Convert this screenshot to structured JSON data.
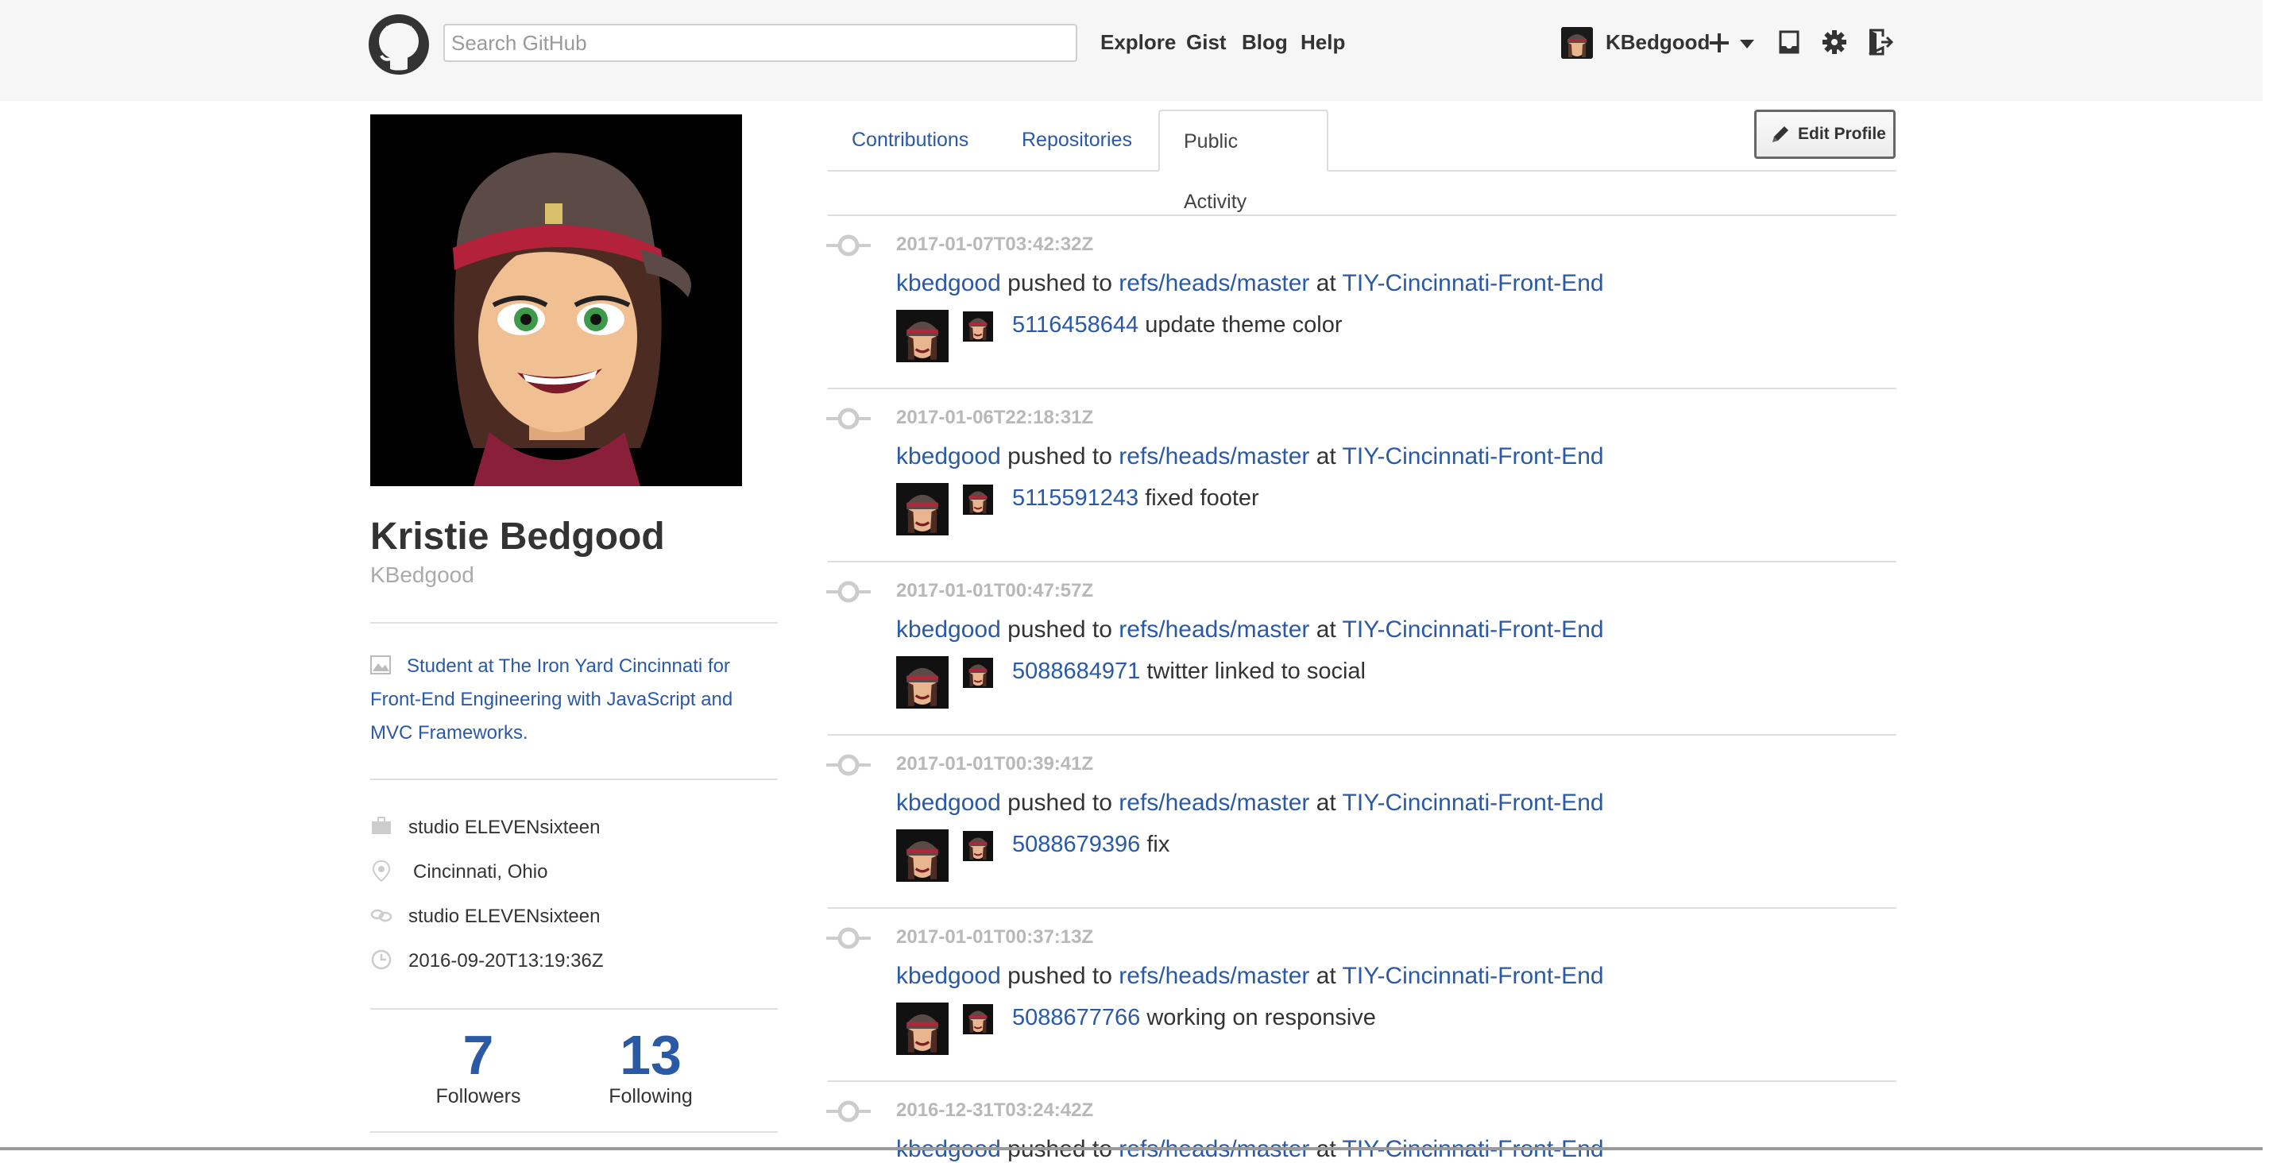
{
  "header": {
    "search_placeholder": "Search GitHub",
    "nav": [
      "Explore",
      "Gist",
      "Blog",
      "Help"
    ],
    "username": "KBedgood",
    "icons": [
      "github-logo-icon",
      "plus-icon",
      "chevron-down-icon",
      "inbox-icon",
      "gear-icon",
      "sign-out-icon"
    ]
  },
  "profile": {
    "full_name": "Kristie Bedgood",
    "login": "KBedgood",
    "bio": "Student at The Iron Yard Cincinnati for Front-End Engineering with JavaScript and MVC Frameworks.",
    "company": "studio ELEVENsixteen",
    "location": "Cincinnati, Ohio",
    "website": "studio ELEVENsixteen",
    "joined": "2016-09-20T13:19:36Z",
    "followers_count": "7",
    "followers_label": "Followers",
    "following_count": "13",
    "following_label": "Following"
  },
  "tabs": {
    "contributions": "Contributions",
    "repositories": "Repositories",
    "public_activity": "Public Activity",
    "active": "Public Activity"
  },
  "edit_profile_label": "Edit Profile",
  "events": [
    {
      "time": "2017-01-07T03:42:32Z",
      "actor": "kbedgood",
      "verb": "pushed to",
      "ref": "refs/heads/master",
      "prep": "at",
      "repo": "TIY-Cincinnati-Front-End",
      "sha": "5116458644",
      "message": "update theme color"
    },
    {
      "time": "2017-01-06T22:18:31Z",
      "actor": "kbedgood",
      "verb": "pushed to",
      "ref": "refs/heads/master",
      "prep": "at",
      "repo": "TIY-Cincinnati-Front-End",
      "sha": "5115591243",
      "message": "fixed footer"
    },
    {
      "time": "2017-01-01T00:47:57Z",
      "actor": "kbedgood",
      "verb": "pushed to",
      "ref": "refs/heads/master",
      "prep": "at",
      "repo": "TIY-Cincinnati-Front-End",
      "sha": "5088684971",
      "message": "twitter linked to social"
    },
    {
      "time": "2017-01-01T00:39:41Z",
      "actor": "kbedgood",
      "verb": "pushed to",
      "ref": "refs/heads/master",
      "prep": "at",
      "repo": "TIY-Cincinnati-Front-End",
      "sha": "5088679396",
      "message": "fix"
    },
    {
      "time": "2017-01-01T00:37:13Z",
      "actor": "kbedgood",
      "verb": "pushed to",
      "ref": "refs/heads/master",
      "prep": "at",
      "repo": "TIY-Cincinnati-Front-End",
      "sha": "5088677766",
      "message": "working on responsive"
    },
    {
      "time": "2016-12-31T03:24:42Z",
      "actor": "kbedgood",
      "verb": "pushed to",
      "ref": "refs/heads/master",
      "prep": "at",
      "repo": "TIY-Cincinnati-Front-End",
      "sha": "",
      "message": ""
    }
  ],
  "colors": {
    "link": "#2a5aa5",
    "header_bg": "#f6f6f6",
    "timestamp": "#b8b8b8"
  }
}
